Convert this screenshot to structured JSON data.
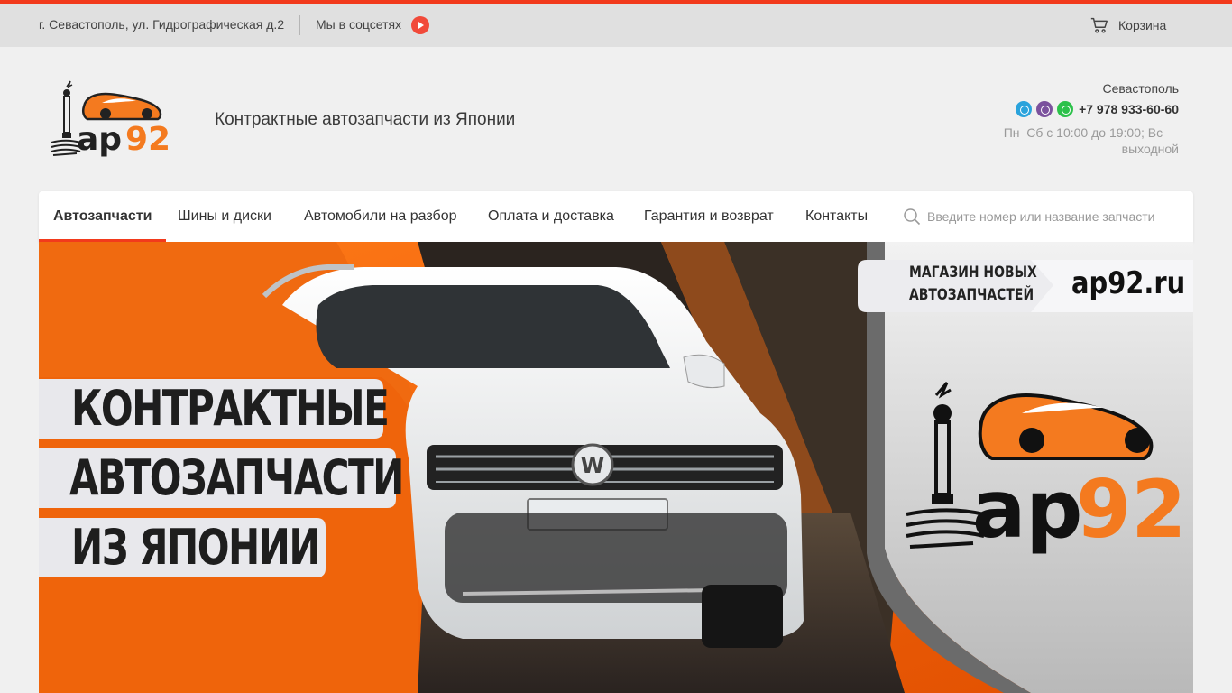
{
  "topbar": {
    "address": "г. Севастополь, ул. Гидрографическая д.2",
    "social_label": "Мы в соцсетях",
    "cart_label": "Корзина"
  },
  "header": {
    "logo": {
      "text_ap": "ap",
      "text_92": "92"
    },
    "tagline": "Контрактные автозапчасти из Японии",
    "city": "Севастополь",
    "phone": "+7 978 933-60-60",
    "hours": "Пн–Сб с 10:00 до 19:00; Вс — выходной"
  },
  "nav": {
    "items": [
      {
        "label": "Автозапчасти",
        "active": true
      },
      {
        "label": "Шины и диски"
      },
      {
        "label": "Автомобили на разбор"
      },
      {
        "label": "Оплата и доставка"
      },
      {
        "label": "Гарантия и возврат"
      },
      {
        "label": "Контакты"
      }
    ],
    "search_placeholder": "Введите номер или название запчасти"
  },
  "banner": {
    "lines": [
      "КОНТРАКТНЫЕ",
      "АВТОЗАПЧАСТИ",
      "ИЗ ЯПОНИИ"
    ],
    "shop_tag_line1": "МАГАЗИН НОВЫХ",
    "shop_tag_line2": "АВТОЗАПЧАСТЕЙ",
    "site": "ap92.ru",
    "logo_ap": "ap",
    "logo_92": "92"
  },
  "colors": {
    "accent": "#f23a1c",
    "orange": "#f47a1f",
    "topbar_bg": "#e0e0e0",
    "page_bg": "#f0f0f0"
  }
}
